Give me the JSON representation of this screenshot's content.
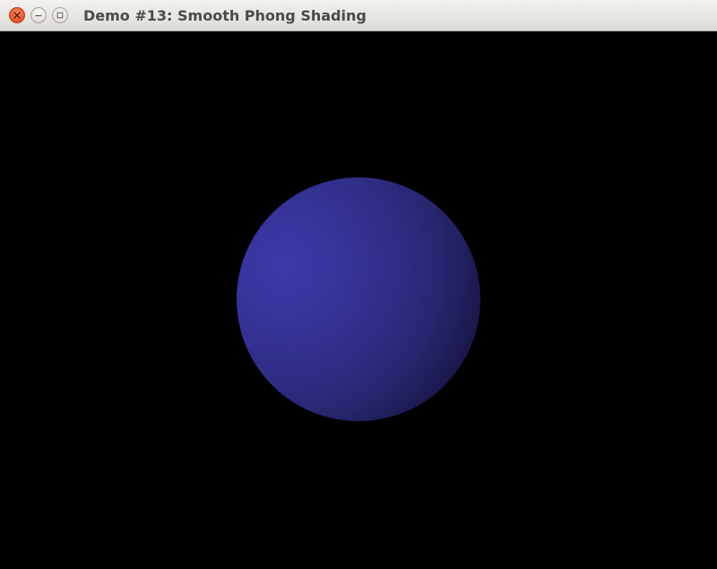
{
  "window": {
    "title": "Demo #13: Smooth Phong Shading",
    "controls": {
      "close": "close-icon",
      "minimize": "minimize-icon",
      "maximize": "maximize-icon"
    }
  },
  "scene": {
    "background_color": "#000000",
    "object": "sphere",
    "sphere_color": "#37349a"
  }
}
